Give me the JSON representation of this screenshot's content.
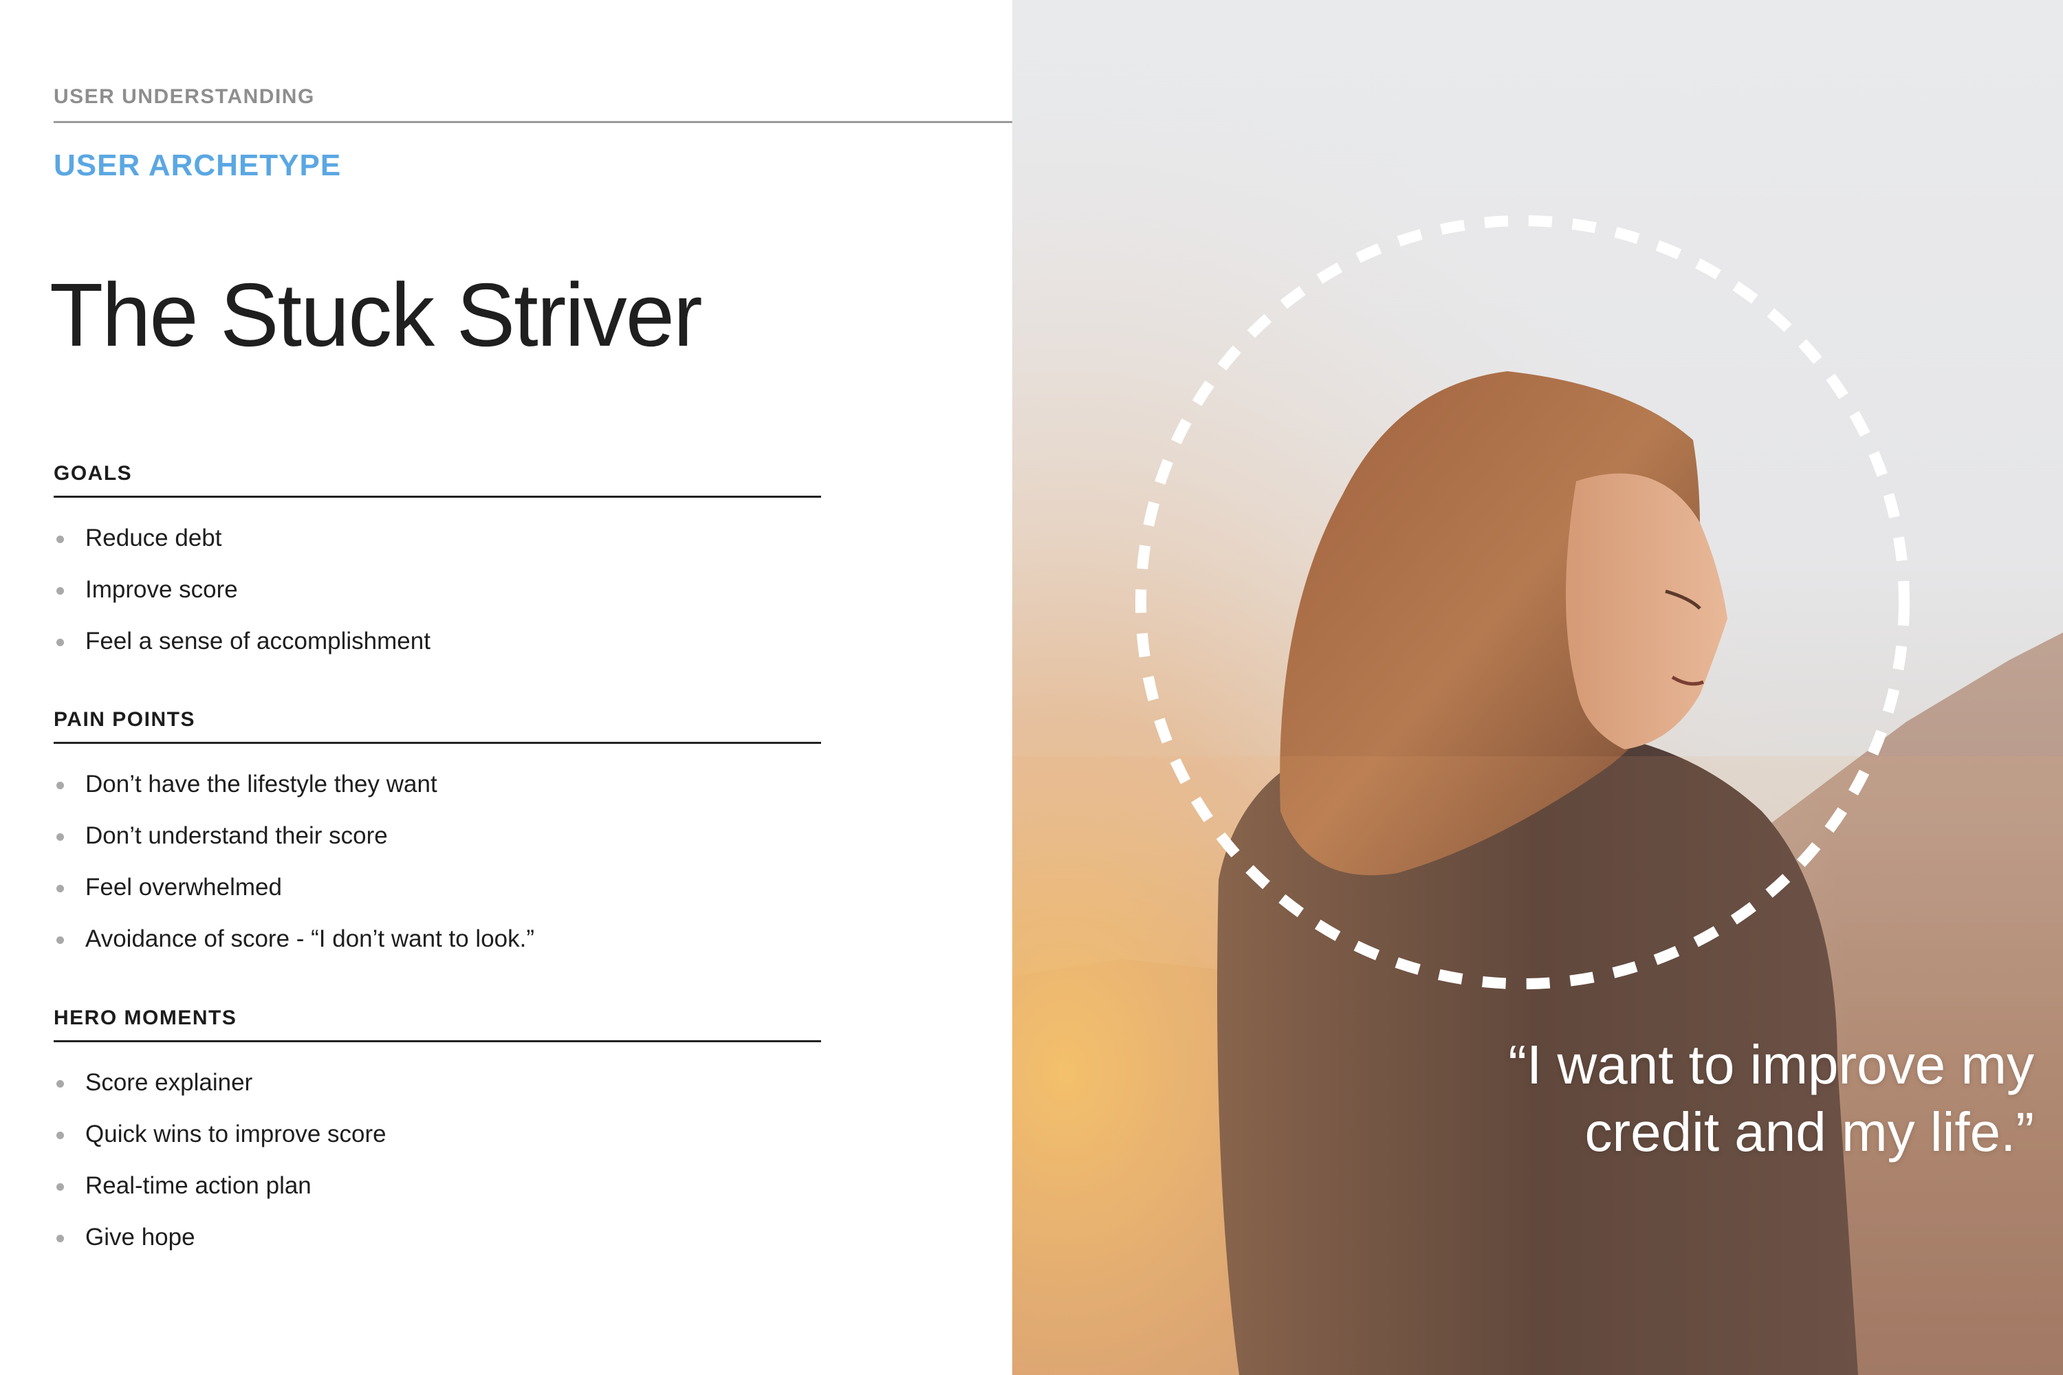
{
  "header": {
    "eyebrow": "USER UNDERSTANDING",
    "subtitle": "USER ARCHETYPE",
    "title": "The Stuck Striver"
  },
  "sections": {
    "goals": {
      "heading": "GOALS",
      "items": [
        "Reduce debt",
        "Improve score",
        "Feel a sense of accomplishment"
      ]
    },
    "pain_points": {
      "heading": "PAIN POINTS",
      "items": [
        "Don’t have the lifestyle they want",
        "Don’t understand their score",
        "Feel overwhelmed",
        "Avoidance of score - “I don’t want to look.”"
      ]
    },
    "hero_moments": {
      "heading": "HERO MOMENTS",
      "items": [
        "Score explainer",
        "Quick wins to improve score",
        "Real-time action plan",
        "Give hope"
      ]
    }
  },
  "photo": {
    "quote_line1": "“I want to improve my",
    "quote_line2": "credit and my life.”"
  },
  "colors": {
    "accent": "#5aa7e3",
    "heading_gray": "#8e8e8e",
    "text": "#1e1e1e"
  }
}
